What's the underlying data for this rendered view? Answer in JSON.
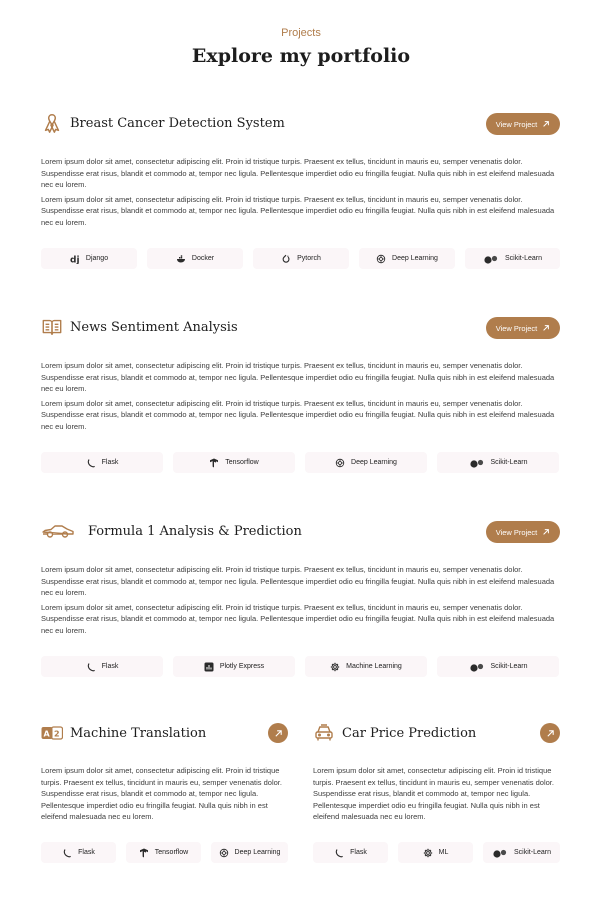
{
  "section": {
    "eyebrow": "Projects",
    "heading": "Explore my portfolio"
  },
  "colors": {
    "accent": "#b07d4c",
    "tag_bg": "#fbf6f8",
    "text": "#1d1d1d"
  },
  "lorem": {
    "long": "Lorem ipsum dolor sit amet, consectetur adipiscing elit. Proin id tristique turpis. Praesent ex tellus, tincidunt in mauris eu, semper venenatis dolor. Suspendisse erat risus, blandit et commodo at, tempor nec ligula. Pellentesque imperdiet odio eu fringilla feugiat. Nulla quis nibh in est eleifend malesuada nec eu lorem."
  },
  "projects": [
    {
      "title": "Breast Cancer Detection System",
      "icon": "ribbon-icon",
      "button": "View Project",
      "paragraphs": [
        "Lorem ipsum dolor sit amet, consectetur adipiscing elit. Proin id tristique turpis. Praesent ex tellus, tincidunt in mauris eu, semper venenatis dolor. Suspendisse erat risus, blandit et commodo at, tempor nec ligula. Pellentesque imperdiet odio eu fringilla feugiat. Nulla quis nibh in est eleifend malesuada nec eu lorem.",
        "Lorem ipsum dolor sit amet, consectetur adipiscing elit. Proin id tristique turpis. Praesent ex tellus, tincidunt in mauris eu, semper venenatis dolor. Suspendisse erat risus, blandit et commodo at, tempor nec ligula. Pellentesque imperdiet odio eu fringilla feugiat. Nulla quis nibh in est eleifend malesuada nec eu lorem."
      ],
      "tags": [
        {
          "label": "Django",
          "icon": "django-icon"
        },
        {
          "label": "Docker",
          "icon": "docker-icon"
        },
        {
          "label": "Pytorch",
          "icon": "pytorch-icon"
        },
        {
          "label": "Deep Learning",
          "icon": "brain-icon"
        },
        {
          "label": "Scikit-Learn",
          "icon": "scikit-learn-icon"
        }
      ]
    },
    {
      "title": "News Sentiment Analysis",
      "icon": "newspaper-icon",
      "button": "View Project",
      "paragraphs": [
        "Lorem ipsum dolor sit amet, consectetur adipiscing elit. Proin id tristique turpis. Praesent ex tellus, tincidunt in mauris eu, semper venenatis dolor. Suspendisse erat risus, blandit et commodo at, tempor nec ligula. Pellentesque imperdiet odio eu fringilla feugiat. Nulla quis nibh in est eleifend malesuada nec eu lorem.",
        "Lorem ipsum dolor sit amet, consectetur adipiscing elit. Proin id tristique turpis. Praesent ex tellus, tincidunt in mauris eu, semper venenatis dolor. Suspendisse erat risus, blandit et commodo at, tempor nec ligula. Pellentesque imperdiet odio eu fringilla feugiat. Nulla quis nibh in est eleifend malesuada nec eu lorem."
      ],
      "tags": [
        {
          "label": "Flask",
          "icon": "flask-icon"
        },
        {
          "label": "Tensorflow",
          "icon": "tensorflow-icon"
        },
        {
          "label": "Deep Learning",
          "icon": "brain-icon"
        },
        {
          "label": "Scikit-Learn",
          "icon": "scikit-learn-icon"
        }
      ]
    },
    {
      "title": "Formula 1 Analysis & Prediction",
      "icon": "race-car-icon",
      "button": "View Project",
      "paragraphs": [
        "Lorem ipsum dolor sit amet, consectetur adipiscing elit. Proin id tristique turpis. Praesent ex tellus, tincidunt in mauris eu, semper venenatis dolor. Suspendisse erat risus, blandit et commodo at, tempor nec ligula. Pellentesque imperdiet odio eu fringilla feugiat. Nulla quis nibh in est eleifend malesuada nec eu lorem.",
        "Lorem ipsum dolor sit amet, consectetur adipiscing elit. Proin id tristique turpis. Praesent ex tellus, tincidunt in mauris eu, semper venenatis dolor. Suspendisse erat risus, blandit et commodo at, tempor nec ligula. Pellentesque imperdiet odio eu fringilla feugiat. Nulla quis nibh in est eleifend malesuada nec eu lorem."
      ],
      "tags": [
        {
          "label": "Flask",
          "icon": "flask-icon"
        },
        {
          "label": "Plotly Express",
          "icon": "plotly-icon"
        },
        {
          "label": "Machine Learning",
          "icon": "gear-icon"
        },
        {
          "label": "Scikit-Learn",
          "icon": "scikit-learn-icon"
        }
      ]
    },
    {
      "title": "Machine Translation",
      "icon": "translate-icon",
      "paragraph": "Lorem ipsum dolor sit amet, consectetur adipiscing elit. Proin id tristique turpis. Praesent ex tellus, tincidunt in mauris eu, semper venenatis dolor. Suspendisse erat risus, blandit et commodo at, tempor nec ligula. Pellentesque imperdiet odio eu fringilla feugiat. Nulla quis nibh in est eleifend malesuada nec eu lorem.",
      "tags": [
        {
          "label": "Flask",
          "icon": "flask-icon"
        },
        {
          "label": "Tensorflow",
          "icon": "tensorflow-icon"
        },
        {
          "label": "Deep Learning",
          "icon": "brain-icon"
        }
      ]
    },
    {
      "title": "Car Price Prediction",
      "icon": "car-icon",
      "paragraph": "Lorem ipsum dolor sit amet, consectetur adipiscing elit. Proin id tristique turpis. Praesent ex tellus, tincidunt in mauris eu, semper venenatis dolor. Suspendisse erat risus, blandit et commodo at, tempor nec ligula. Pellentesque imperdiet odio eu fringilla feugiat. Nulla quis nibh in est eleifend malesuada nec eu lorem.",
      "tags": [
        {
          "label": "Flask",
          "icon": "flask-icon"
        },
        {
          "label": "ML",
          "icon": "gear-icon"
        },
        {
          "label": "Scikit-Learn",
          "icon": "scikit-learn-icon"
        }
      ]
    }
  ]
}
